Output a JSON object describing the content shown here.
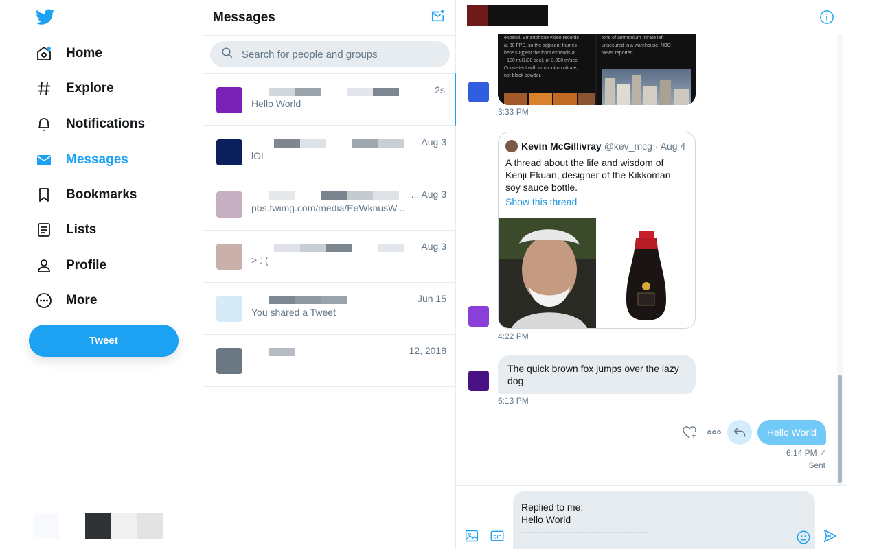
{
  "nav": {
    "items": [
      {
        "label": "Home",
        "icon": "home-icon"
      },
      {
        "label": "Explore",
        "icon": "hashtag-icon"
      },
      {
        "label": "Notifications",
        "icon": "bell-icon"
      },
      {
        "label": "Messages",
        "icon": "envelope-icon",
        "active": true
      },
      {
        "label": "Bookmarks",
        "icon": "bookmark-icon"
      },
      {
        "label": "Lists",
        "icon": "list-icon"
      },
      {
        "label": "Profile",
        "icon": "person-icon"
      },
      {
        "label": "More",
        "icon": "more-circle-icon"
      }
    ],
    "tweet_label": "Tweet",
    "accent": "#1da1f2"
  },
  "list": {
    "title": "Messages",
    "search_placeholder": "Search for people and groups",
    "conversations": [
      {
        "time": "2s",
        "preview": "Hello World",
        "avatar_color": "#7a22b5"
      },
      {
        "time": "Aug 3",
        "preview": "lOL",
        "avatar_color": "#0a1f5c"
      },
      {
        "time": "... Aug 3",
        "preview": "pbs.twimg.com/media/EeWknusW...",
        "avatar_color": "#c7afc2"
      },
      {
        "time": "Aug 3",
        "preview": "> : (",
        "avatar_color": "#c9b0ab"
      },
      {
        "time": "Jun 15",
        "preview": "You shared a Tweet",
        "avatar_color": "#d6eaf8"
      },
      {
        "time": "12, 2018",
        "preview": "",
        "avatar_color": "#6b7782"
      }
    ]
  },
  "chat": {
    "image_card_left": [
      "expand. Smartphone video records",
      "at 30 FPS, so the adjacent frames",
      "here suggest the front expands at",
      "~100 m/(1/30 sec), or 3,000 m/sec.",
      "Consistent with ammonium nitrate,",
      "not black powder."
    ],
    "image_card_right": [
      "tons of ammonium nitrate left",
      "unsecured in a warehouse, NBC",
      "News reported."
    ],
    "time_1": "3:33 PM",
    "quote": {
      "name": "Kevin McGillivray",
      "handle": "@kev_mcg · Aug 4",
      "text": "A thread about the life and wisdom of Kenji Ekuan, designer of the Kikkoman soy sauce bottle.",
      "link": "Show this thread"
    },
    "time_2": "4:22 PM",
    "incoming": "The quick brown fox jumps over the lazy dog",
    "time_3": "6:13 PM",
    "outgoing": "Hello World",
    "time_4": "6:14 PM ✓",
    "status": "Sent",
    "composer_text": "Replied to me:\nHello World\n----------------------------------------",
    "avatar_colors": [
      "#2f5fe0",
      "#8a3fd9",
      "#4a1184"
    ]
  }
}
